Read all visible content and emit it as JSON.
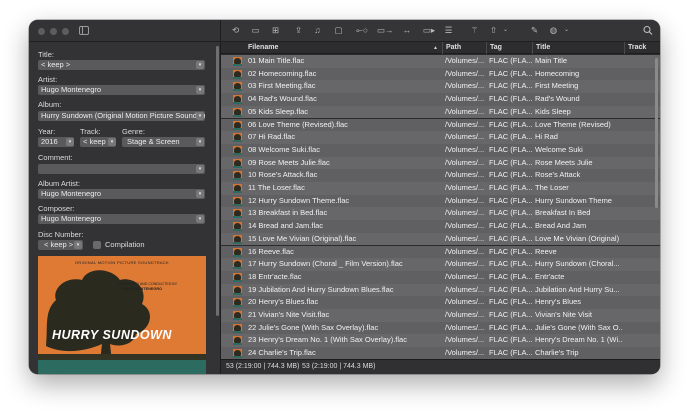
{
  "colors": {
    "window_bg": "#2b2b2b",
    "row_bg": "#676769",
    "field_bg": "#5a5a5c",
    "cover_orange": "#df7a35",
    "cover_teal": "#2c6b60"
  },
  "left": {
    "title_label": "Title:",
    "title_value": "< keep >",
    "artist_label": "Artist:",
    "artist_value": "Hugo Montenegro",
    "album_label": "Album:",
    "album_value": "Hurry Sundown (Original Motion Picture Soundtrack)",
    "year_label": "Year:",
    "year_value": "2016",
    "track_label": "Track:",
    "track_value": "< keep",
    "genre_label": "Genre:",
    "genre_value": "Stage & Screen",
    "comment_label": "Comment:",
    "comment_value": "",
    "album_artist_label": "Album Artist:",
    "album_artist_value": "Hugo Montenegro",
    "composer_label": "Composer:",
    "composer_value": "Hugo Montenegro",
    "disc_label": "Disc Number:",
    "disc_value": "< keep >",
    "compilation_label": "Compilation",
    "cover": {
      "top_text": "ORIGINAL MOTION PICTURE SOUNDTRACK",
      "credit_line1": "COMPOSED AND CONDUCTED BY",
      "credit_line2": "HUGO MONTENEGRO",
      "title": "HURRY SUNDOWN"
    }
  },
  "toolbar": {
    "icons": [
      "tag-icon",
      "folder-icon",
      "add-folder-icon",
      "export-icon",
      "music-note-icon",
      "file-to-tag-icon",
      "tag-to-file-icon",
      "convert-icon",
      "rename-icon",
      "actions-list-icon",
      "magic-wand-icon",
      "export-dropdown-icon",
      "edit-icon",
      "globe-icon",
      "search-icon"
    ]
  },
  "columns": {
    "filename": "Filename",
    "path": "Path",
    "tag": "Tag",
    "title": "Title",
    "track": "Track"
  },
  "rows": [
    {
      "filename": "01 Main Title.flac",
      "path": "/Volumes/...",
      "tag": "FLAC (FLA...",
      "title": "Main Title"
    },
    {
      "filename": "02 Homecoming.flac",
      "path": "/Volumes/...",
      "tag": "FLAC (FLA...",
      "title": "Homecoming"
    },
    {
      "filename": "03 First Meeting.flac",
      "path": "/Volumes/...",
      "tag": "FLAC (FLA...",
      "title": "First Meeting"
    },
    {
      "filename": "04 Rad's Wound.flac",
      "path": "/Volumes/...",
      "tag": "FLAC (FLA...",
      "title": "Rad's Wound"
    },
    {
      "filename": "05 Kids Sleep.flac",
      "path": "/Volumes/...",
      "tag": "FLAC (FLA...",
      "title": "Kids Sleep"
    },
    {
      "filename": "06 Love Theme (Revised).flac",
      "path": "/Volumes/...",
      "tag": "FLAC (FLA...",
      "title": "Love Theme (Revised)"
    },
    {
      "filename": "07 Hi Rad.flac",
      "path": "/Volumes/...",
      "tag": "FLAC (FLA...",
      "title": "Hi Rad"
    },
    {
      "filename": "08 Welcome Suki.flac",
      "path": "/Volumes/...",
      "tag": "FLAC (FLA...",
      "title": "Welcome Suki"
    },
    {
      "filename": "09 Rose Meets Julie.flac",
      "path": "/Volumes/...",
      "tag": "FLAC (FLA...",
      "title": "Rose Meets Julie"
    },
    {
      "filename": "10 Rose's Attack.flac",
      "path": "/Volumes/...",
      "tag": "FLAC (FLA...",
      "title": "Rose's Attack"
    },
    {
      "filename": "11 The Loser.flac",
      "path": "/Volumes/...",
      "tag": "FLAC (FLA...",
      "title": "The Loser"
    },
    {
      "filename": "12 Hurry Sundown Theme.flac",
      "path": "/Volumes/...",
      "tag": "FLAC (FLA...",
      "title": "Hurry Sundown Theme"
    },
    {
      "filename": "13 Breakfast in Bed.flac",
      "path": "/Volumes/...",
      "tag": "FLAC (FLA...",
      "title": "Breakfast In Bed"
    },
    {
      "filename": "14 Bread and Jam.flac",
      "path": "/Volumes/...",
      "tag": "FLAC (FLA...",
      "title": "Bread And Jam"
    },
    {
      "filename": "15 Love Me Vivian (Original).flac",
      "path": "/Volumes/...",
      "tag": "FLAC (FLA...",
      "title": "Love Me Vivian (Original)"
    },
    {
      "filename": "16 Reeve.flac",
      "path": "/Volumes/...",
      "tag": "FLAC (FLA...",
      "title": "Reeve"
    },
    {
      "filename": "17 Hurry Sundown (Choral _ Film Version).flac",
      "path": "/Volumes/...",
      "tag": "FLAC (FLA...",
      "title": "Hurry Sundown (Choral..."
    },
    {
      "filename": "18 Entr'acte.flac",
      "path": "/Volumes/...",
      "tag": "FLAC (FLA...",
      "title": "Entr'acte"
    },
    {
      "filename": "19 Jubilation And Hurry Sundown Blues.flac",
      "path": "/Volumes/...",
      "tag": "FLAC (FLA...",
      "title": "Jubilation And Hurry Su..."
    },
    {
      "filename": "20 Henry's Blues.flac",
      "path": "/Volumes/...",
      "tag": "FLAC (FLA...",
      "title": "Henry's Blues"
    },
    {
      "filename": "21 Vivian's Nite Visit.flac",
      "path": "/Volumes/...",
      "tag": "FLAC (FLA...",
      "title": "Vivian's Nite Visit"
    },
    {
      "filename": "22 Julie's Gone (With Sax Overlay).flac",
      "path": "/Volumes/...",
      "tag": "FLAC (FLA...",
      "title": "Julie's Gone (With Sax O..."
    },
    {
      "filename": "23 Henry's Dream No. 1 (With Sax Overlay).flac",
      "path": "/Volumes/...",
      "tag": "FLAC (FLA...",
      "title": "Henry's Dream No. 1 (Wi..."
    },
    {
      "filename": "24 Charlie's Trip.flac",
      "path": "/Volumes/...",
      "tag": "FLAC (FLA...",
      "title": "Charlie's Trip"
    }
  ],
  "status": {
    "selected": "53 (2:19:00 | 744.3 MB)",
    "total": "53 (2:19:00 | 744.3 MB)"
  }
}
